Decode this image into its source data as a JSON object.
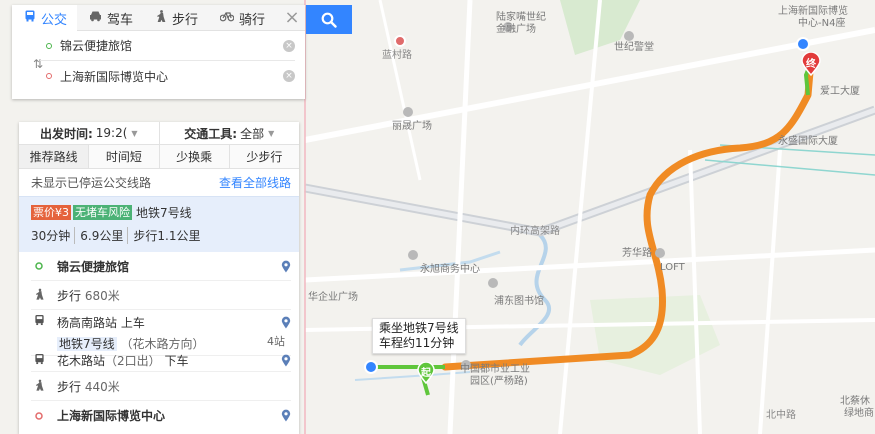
{
  "mode_tabs": [
    {
      "label": "公交",
      "icon": "bus-icon",
      "active": true
    },
    {
      "label": "驾车",
      "icon": "car-icon",
      "active": false
    },
    {
      "label": "步行",
      "icon": "walk-icon",
      "active": false
    },
    {
      "label": "骑行",
      "icon": "bike-icon",
      "active": false
    }
  ],
  "route": {
    "start": "锦云便捷旅馆",
    "end": "上海新国际博览中心"
  },
  "options": {
    "depart_label": "出发时间:",
    "depart_value": "19:2(",
    "transport_label": "交通工具:",
    "transport_value": "全部"
  },
  "preferences": [
    "推荐路线",
    "时间短",
    "少换乘",
    "少步行"
  ],
  "notice": {
    "text": "未显示已停运公交线路",
    "link": "查看全部线路"
  },
  "plan": {
    "price_tag": "票价¥3",
    "jam_tag": "无堵车风险",
    "line": "地铁7号线",
    "duration": "30分钟",
    "distance": "6.9公里",
    "walk": "步行1.1公里"
  },
  "steps": {
    "start": "锦云便捷旅馆",
    "walk1_prefix": "步行",
    "walk1_dist": "680米",
    "board_station": "杨高南路站",
    "board_action": "上车",
    "line_name": "地铁7号线",
    "line_dir": "（花木路方向）",
    "stops": "4站",
    "alight_station": "花木路站",
    "alight_exit": "（2口出）",
    "alight_action": "下车",
    "walk2_prefix": "步行",
    "walk2_dist": "440米",
    "end": "上海新国际博览中心"
  },
  "map": {
    "tip_line1": "乘坐地铁7号线",
    "tip_line2": "车程约11分钟",
    "start_marker": "起",
    "end_marker": "终",
    "labels": [
      "陆家嘴世纪",
      "金融广场",
      "世纪警堂",
      "蓝村路",
      "丽晟广场",
      "内环高架路",
      "永旭商务中心",
      "华企业广场",
      "浦东图书馆",
      "芳华路",
      "LOFT",
      "中国都市业工业",
      "园区(严杨路)",
      "北中路",
      "上海新国际博览",
      "中心-N4座",
      "爱工大厦",
      "永盛国际大厦",
      "北蔡休",
      "绿地商"
    ]
  },
  "colors": {
    "accent": "#3385ff",
    "route_orange": "#f08b24",
    "walk_green": "#5fc63b",
    "price_tag": "#e5633c",
    "nojam_tag": "#4cb276"
  }
}
